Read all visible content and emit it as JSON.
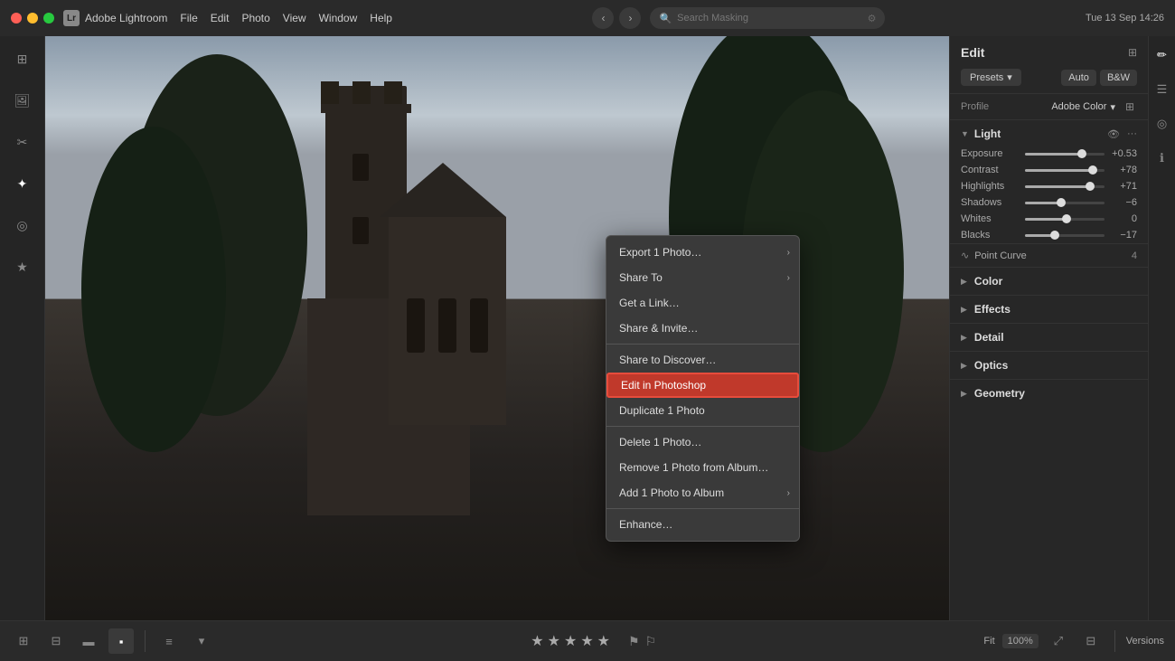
{
  "titlebar": {
    "app_name": "Adobe Lightroom",
    "menu": [
      "Adobe Lightroom",
      "File",
      "Edit",
      "Photo",
      "View",
      "Window",
      "Help"
    ],
    "search_placeholder": "Search Masking",
    "datetime": "Tue 13 Sep  14:26",
    "nav_back": "‹",
    "nav_forward": "›"
  },
  "context_menu": {
    "items": [
      {
        "label": "Export 1 Photo…",
        "has_sub": true
      },
      {
        "label": "Share To",
        "has_sub": true
      },
      {
        "label": "Get a Link…",
        "has_sub": false
      },
      {
        "label": "Share & Invite…",
        "has_sub": false
      },
      {
        "label": "Share to Discover…",
        "has_sub": false
      },
      {
        "label": "Edit in Photoshop",
        "highlighted": true,
        "has_sub": false
      },
      {
        "label": "Duplicate 1 Photo",
        "has_sub": false
      },
      {
        "label": "Delete 1 Photo…",
        "has_sub": false
      },
      {
        "label": "Remove 1 Photo from Album…",
        "has_sub": false
      },
      {
        "label": "Add 1 Photo to Album",
        "has_sub": true
      },
      {
        "label": "Enhance…",
        "has_sub": false
      }
    ]
  },
  "right_panel": {
    "title": "Edit",
    "presets_label": "Presets",
    "mode_auto": "Auto",
    "mode_bw": "B&W",
    "profile_label": "Profile",
    "profile_value": "Adobe Color",
    "sections": {
      "light": {
        "label": "Light",
        "sliders": [
          {
            "name": "Exposure",
            "value": "+0.53",
            "pct": 72
          },
          {
            "name": "Contrast",
            "value": "+78",
            "pct": 85
          },
          {
            "name": "Highlights",
            "value": "+71",
            "pct": 82
          },
          {
            "name": "Shadows",
            "value": "−6",
            "pct": 45
          },
          {
            "name": "Whites",
            "value": "0",
            "pct": 52
          },
          {
            "name": "Blacks",
            "value": "−17",
            "pct": 38
          }
        ]
      },
      "curve": {
        "label": "Point Curve",
        "value": "4"
      },
      "color": {
        "label": "Color"
      },
      "effects": {
        "label": "Effects"
      },
      "detail": {
        "label": "Detail"
      },
      "optics": {
        "label": "Optics"
      },
      "geometry": {
        "label": "Geometry"
      }
    }
  },
  "bottom_bar": {
    "fit_label": "Fit",
    "zoom_value": "100%",
    "versions_label": "Versions",
    "stars": [
      "★",
      "★",
      "★",
      "★",
      "★"
    ]
  }
}
